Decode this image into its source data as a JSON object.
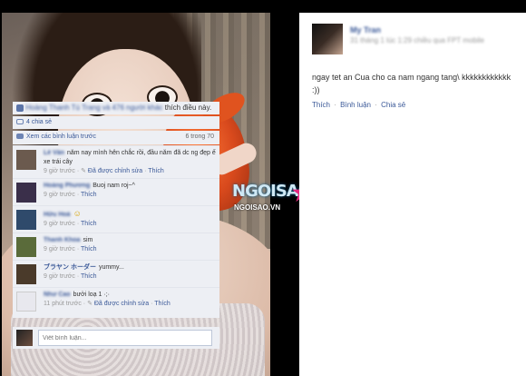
{
  "photo": {
    "alt": ""
  },
  "watermark": {
    "brand": "NGOISAO",
    "site": "NGOISAO.VN"
  },
  "post": {
    "author_name": "My Tran",
    "author_meta": "31 tháng 1 lúc 1:29 chiều qua FPT mobile",
    "text": "ngay tet an Cua cho ca nam ngang tang\\ kkkkkkkkkkkk :))",
    "actions": {
      "like": "Thích",
      "comment": "Bình luận",
      "share": "Chia sẻ"
    },
    "likes": {
      "names": "Hoàng Thanh Tú Trang và 476 người khác",
      "tail": "thích điều này."
    },
    "shares": "4 chia sẻ",
    "more_comments": {
      "label": "Xem các bình luận trước",
      "count": "6 trong 70"
    }
  },
  "comments": [
    {
      "name": "Lê Văn",
      "text": "năm nay mình hên chắc rồi, đầu năm đã dc ng đẹp ế xe trái cây",
      "meta": "9 giờ trước · ",
      "edited": "Đã được chỉnh sửa",
      "like": "Thích",
      "avatar_color": "#6b5a4e"
    },
    {
      "name": "Hoàng Phương",
      "text": "Buoj nam roj~^",
      "meta": "9 giờ trước · ",
      "edited": "",
      "like": "Thích",
      "avatar_color": "#3a2f4a"
    },
    {
      "name": "Hữu Hoà",
      "text": "☺",
      "meta": "9 giờ trước · ",
      "edited": "",
      "like": "Thích",
      "avatar_color": "#2f4a6b"
    },
    {
      "name": "Thanh Khoa",
      "text": "sim",
      "meta": "9 giờ trước · ",
      "edited": "",
      "like": "Thích",
      "avatar_color": "#5a6b3a"
    },
    {
      "name": "ブラヤン ホーダー",
      "text": "yummy...",
      "meta": "9 giờ trước · ",
      "edited": "",
      "like": "Thích",
      "avatar_color": "#4a3a2a"
    },
    {
      "name": "Như Cao",
      "text": "bưởi loạ 1 ·;·",
      "meta": "11 phút trước · ",
      "edited": "Đã được chỉnh sửa",
      "like": "Thích",
      "avatar_color": "#e8e8ee"
    }
  ],
  "reply": {
    "placeholder": "Viết bình luận..."
  }
}
